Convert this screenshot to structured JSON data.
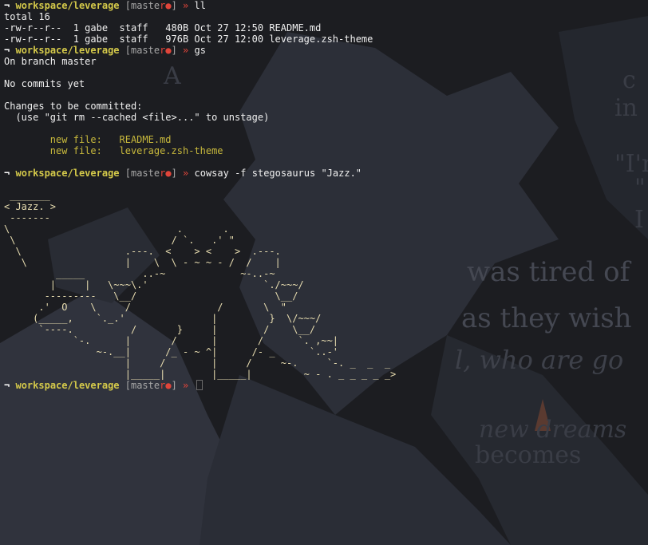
{
  "prompt": {
    "arrow": "¬",
    "dir": "workspace/leverage",
    "branch_open": "[maste",
    "branch_dot": "r●",
    "branch_close": "]",
    "chevron": "»"
  },
  "commands": {
    "c1": "ll",
    "c2": "gs",
    "c3": "cowsay -f stegosaurus \"Jazz.\""
  },
  "ll_output": {
    "total": "total 16",
    "files": [
      "-rw-r--r--  1 gabe  staff   480B Oct 27 12:50 README.md",
      "-rw-r--r--  1 gabe  staff   976B Oct 27 12:00 leverage.zsh-theme"
    ]
  },
  "gs_output": {
    "branch": "On branch master",
    "no_commits": "No commits yet",
    "changes_header": "Changes to be committed:",
    "hint": "  (use \"git rm --cached <file>...\" to unstage)",
    "staged": [
      "        new file:   README.md",
      "        new file:   leverage.zsh-theme"
    ]
  },
  "cowsay_output": [
    " _______",
    "< Jazz. >",
    " -------",
    "\\                             .       .",
    " \\                           / `.   .' \"",
    "  \\                  .---.  <    > <    >  .---.",
    "   \\                 |    \\  \\ - ~ ~ - /  /    |",
    "         _____          ..-~             ~-..-~",
    "        |     |   \\~~~\\.'                    `./~~~/",
    "       ---------   \\__/                        \\__/",
    "      .'  O    \\     /               /       \\  \"",
    "     (_____,    `._.'               |         }  \\/~~~/",
    "      `----.          /       }     |        /    \\__/",
    "            `-.      |       /      |       /      `. ,~~|",
    "                ~-.__|      /_ - ~ ^|      /- _      `..-'",
    "                     |     /        |     /     ~-.     `-. _  _  _",
    "                     |_____|        |_____|         ~ - . _ _ _ _ _>"
  ],
  "background_text": [
    "A",
    "c",
    "in",
    "\"I'm",
    "\"",
    "I",
    "was tired of",
    "as they wish",
    "l, who are go",
    "new dreams",
    "becomes"
  ],
  "colors": {
    "background": "#1c1d21",
    "prompt_dir": "#d4c94a",
    "prompt_dot": "#e0453a",
    "staged": "#c7b83c",
    "cow": "#e8ddb0"
  }
}
